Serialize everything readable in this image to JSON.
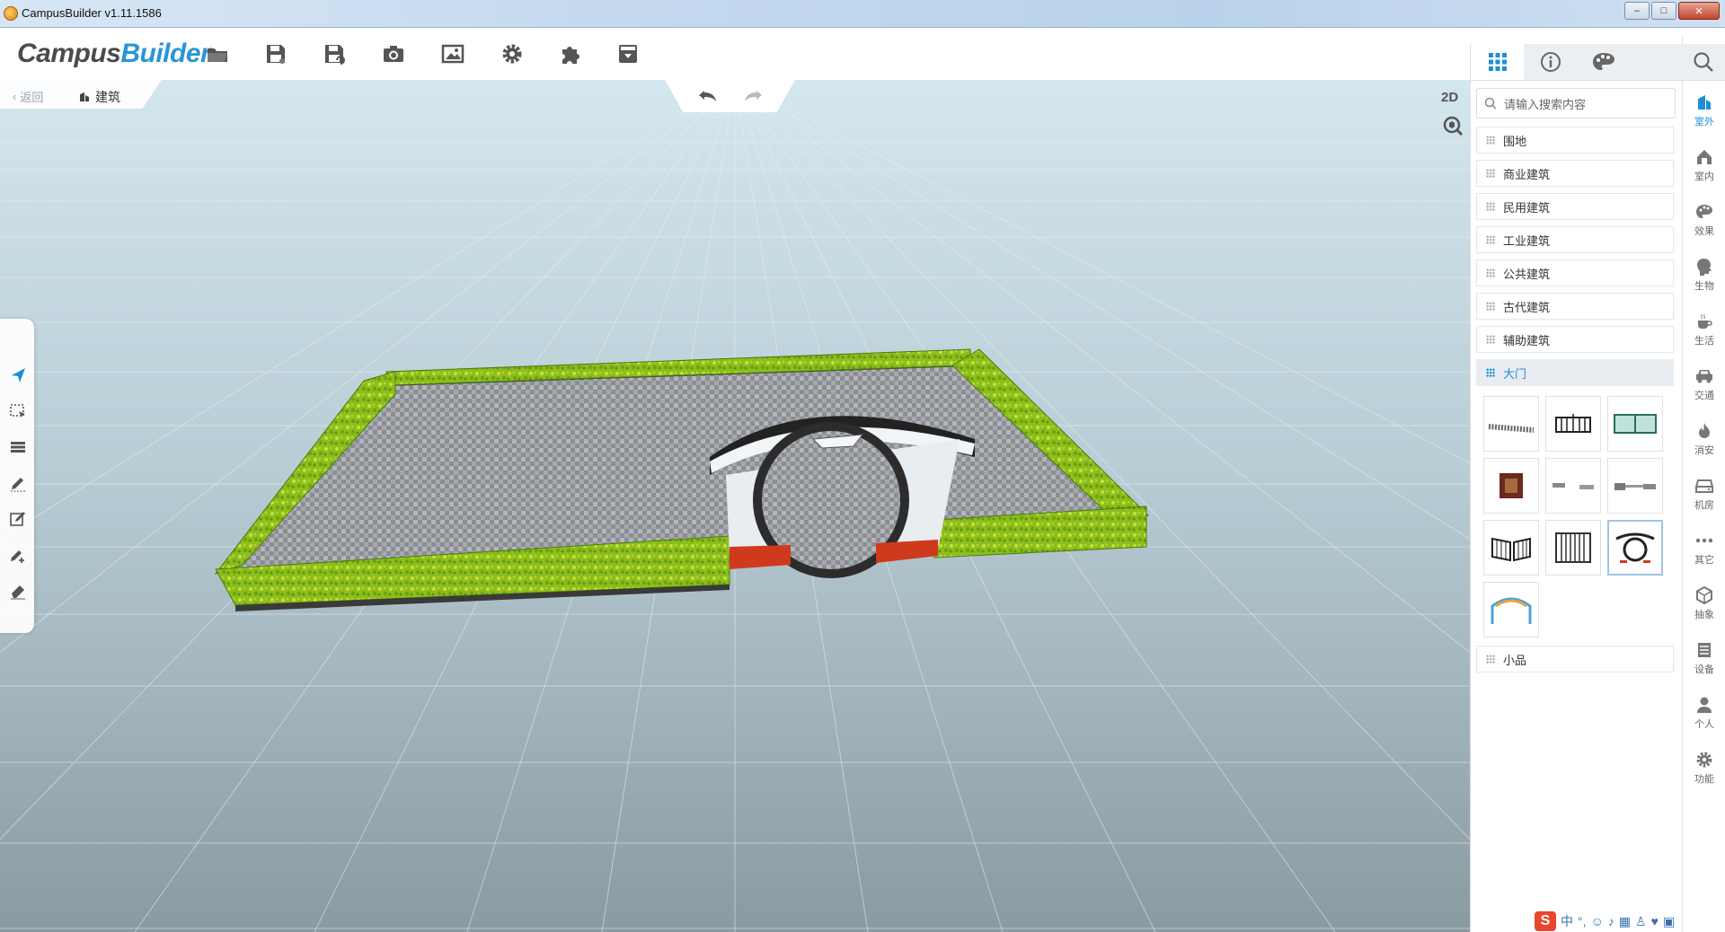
{
  "window": {
    "title": "CampusBuilder v1.11.1586",
    "buttons": [
      "–",
      "□",
      "✕"
    ]
  },
  "toolbar": {
    "logo_part1": "Campus",
    "logo_part2": "Builder",
    "tools": [
      "open-folder-icon",
      "save-icon",
      "save-as-icon",
      "camera-icon",
      "image-icon",
      "gear-icon",
      "puzzle-icon",
      "export-icon"
    ]
  },
  "nav": {
    "back_label": "返回",
    "current_label": "建筑"
  },
  "view": {
    "mode_2d_label": "2D"
  },
  "panel": {
    "tabs": [
      "grid-icon",
      "info-icon",
      "palette-icon"
    ],
    "search_placeholder": "请输入搜索内容",
    "categories": [
      {
        "label": "围地"
      },
      {
        "label": "商业建筑"
      },
      {
        "label": "民用建筑"
      },
      {
        "label": "工业建筑"
      },
      {
        "label": "公共建筑"
      },
      {
        "label": "古代建筑"
      },
      {
        "label": "辅助建筑"
      },
      {
        "label": "大门",
        "active": true
      },
      {
        "label": "小品"
      }
    ],
    "gate_thumbnails": [
      "retractable-gate",
      "iron-gate-dark",
      "glass-gate",
      "wooden-gate",
      "barrier-gate",
      "barrier-gate-long",
      "sliding-gate",
      "fence-gate",
      "moon-gate",
      "arch-gate"
    ],
    "selected_thumbnail": 8
  },
  "sidebar": {
    "items": [
      {
        "label": "室外",
        "icon": "building-icon",
        "active": true
      },
      {
        "label": "室内",
        "icon": "house-icon"
      },
      {
        "label": "效果",
        "icon": "palette-icon"
      },
      {
        "label": "生物",
        "icon": "head-icon"
      },
      {
        "label": "生活",
        "icon": "coffee-icon"
      },
      {
        "label": "交通",
        "icon": "car-icon"
      },
      {
        "label": "消安",
        "icon": "fire-icon"
      },
      {
        "label": "机房",
        "icon": "server-icon"
      },
      {
        "label": "其它",
        "icon": "more-icon"
      },
      {
        "label": "抽象",
        "icon": "cube-icon"
      },
      {
        "label": "设备",
        "icon": "device-icon"
      },
      {
        "label": "个人",
        "icon": "user-icon"
      },
      {
        "label": "功能",
        "icon": "gear-icon"
      }
    ]
  },
  "tray": {
    "ime_logo": "S",
    "ime_mode": "中"
  },
  "colors": {
    "accent": "#1f8ed6",
    "hedge": "#8dc21f",
    "paving": "#8e9296",
    "gate_white": "#e8edf2",
    "gate_red": "#d03a1c"
  }
}
